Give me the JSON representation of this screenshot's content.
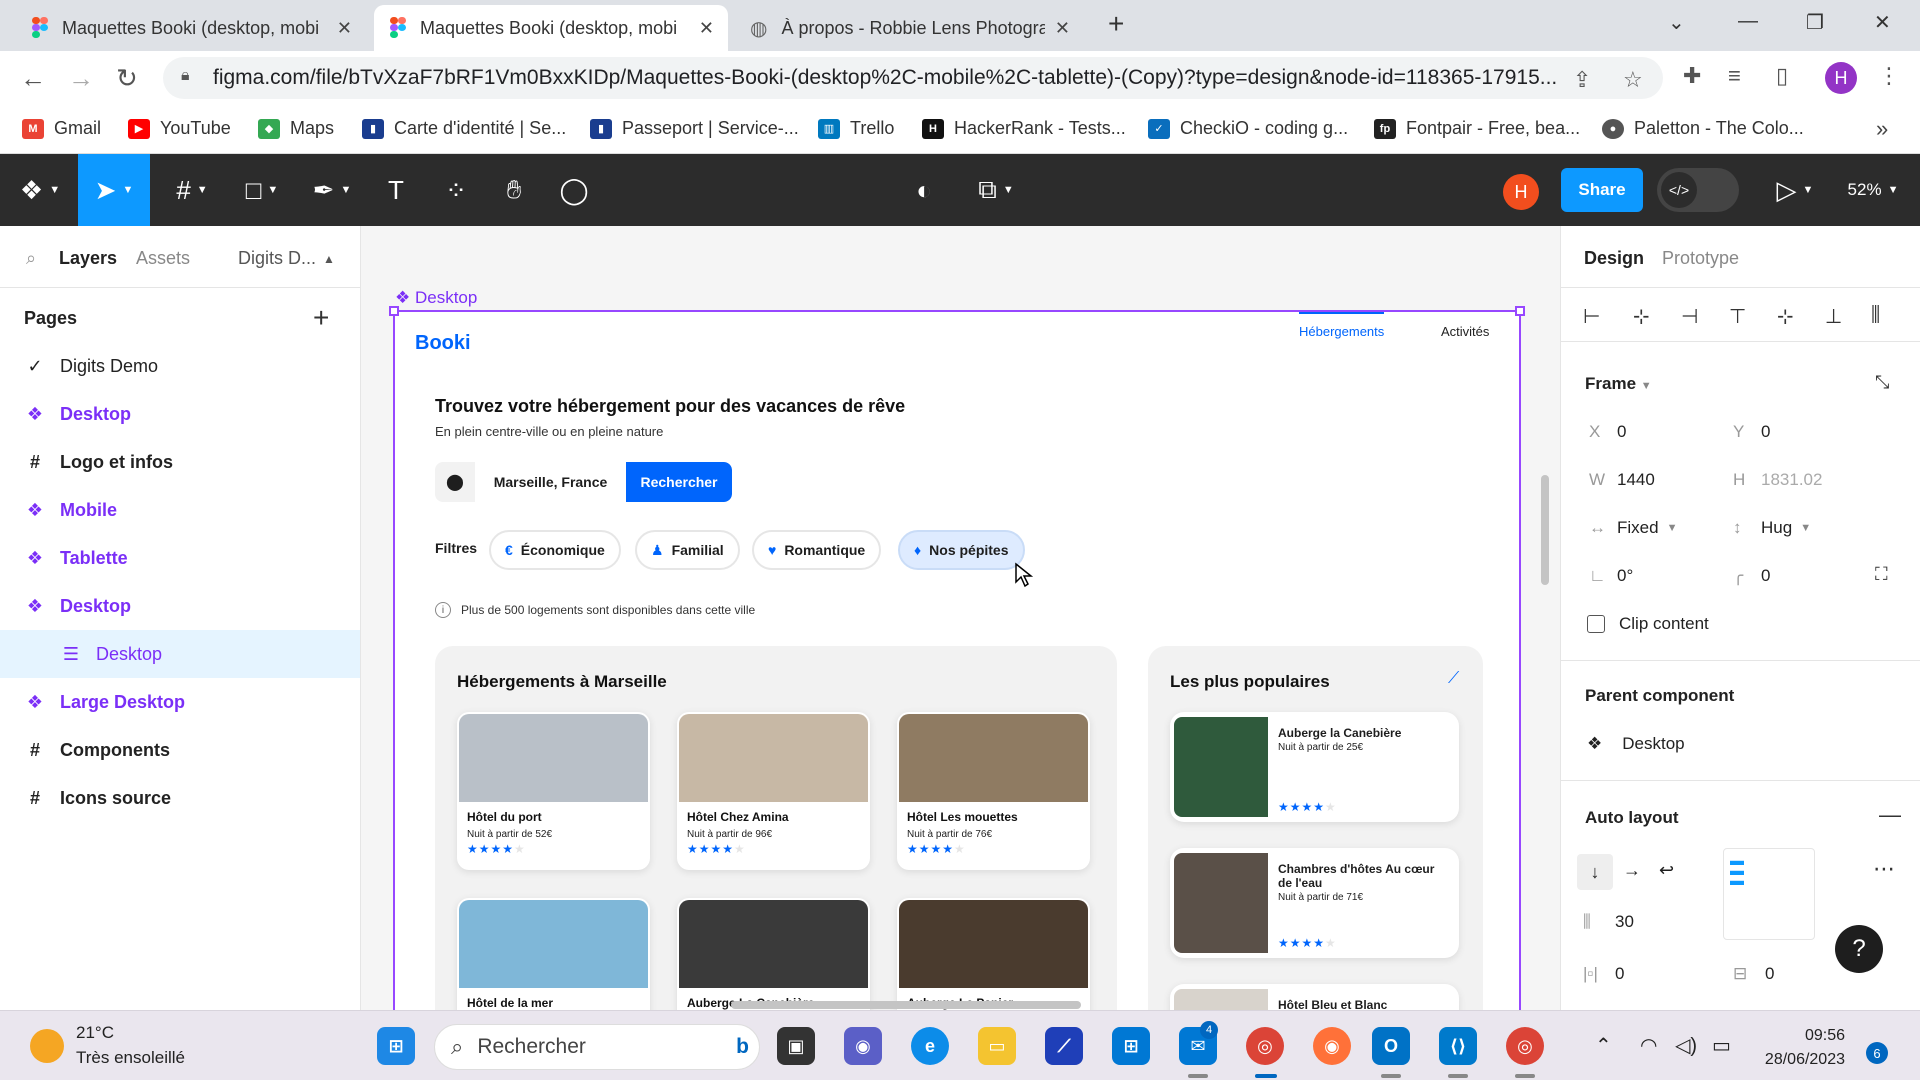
{
  "browser": {
    "tabs": [
      {
        "title": "Maquettes Booki (desktop, mobi",
        "icon": "figma-icon",
        "active": false
      },
      {
        "title": "Maquettes Booki (desktop, mobi",
        "icon": "figma-icon",
        "active": true
      },
      {
        "title": "À propos - Robbie Lens Photogra",
        "icon": "globe-icon",
        "active": false
      }
    ],
    "new_tab": "+",
    "url": "figma.com/file/bTvXzaF7bRF1Vm0BxxKIDp/Maquettes-Booki-(desktop%2C-mobile%2C-tablette)-(Copy)?type=design&node-id=118365-17915...",
    "profile_initial": "H",
    "bookmarks": [
      {
        "label": "Gmail",
        "color": "#ea4335",
        "glyph": "M"
      },
      {
        "label": "YouTube",
        "color": "#ff0000",
        "glyph": "▶"
      },
      {
        "label": "Maps",
        "color": "#34a853",
        "glyph": "◆"
      },
      {
        "label": "Carte d'identité | Se...",
        "color": "#1a3d8f",
        "glyph": "▮"
      },
      {
        "label": "Passeport | Service-...",
        "color": "#1a3d8f",
        "glyph": "▮"
      },
      {
        "label": "Trello",
        "color": "#0079bf",
        "glyph": "▥"
      },
      {
        "label": "HackerRank - Tests...",
        "color": "#111111",
        "glyph": "H"
      },
      {
        "label": "CheckiO - coding g...",
        "color": "#0a6ebd",
        "glyph": "✓"
      },
      {
        "label": "Fontpair - Free, bea...",
        "color": "#222222",
        "glyph": "fp"
      },
      {
        "label": "Paletton - The Colo...",
        "color": "#555555",
        "glyph": "●"
      }
    ],
    "bookmarks_more": "»"
  },
  "figma": {
    "toolbar": {
      "user_initial": "H",
      "share_label": "Share",
      "dev_mode_icon": "</>",
      "zoom": "52%"
    },
    "left_panel": {
      "tabs": [
        "Layers",
        "Assets"
      ],
      "file_name": "Digits D...",
      "pages_heading": "Pages",
      "pages": [
        {
          "label": "Digits Demo",
          "icon": "✓",
          "style": "current"
        },
        {
          "label": "Desktop",
          "icon": "❖",
          "style": "component"
        },
        {
          "label": "Logo et infos",
          "icon": "#",
          "style": "frame"
        },
        {
          "label": "Mobile",
          "icon": "❖",
          "style": "component"
        },
        {
          "label": "Tablette",
          "icon": "❖",
          "style": "component"
        },
        {
          "label": "Desktop",
          "icon": "❖",
          "style": "component"
        },
        {
          "label": "Desktop",
          "icon": "☰",
          "style": "sub"
        },
        {
          "label": "Large Desktop",
          "icon": "❖",
          "style": "component"
        },
        {
          "label": "Components",
          "icon": "#",
          "style": "frame"
        },
        {
          "label": "Icons source",
          "icon": "#",
          "style": "frame"
        }
      ]
    },
    "canvas": {
      "frame_label": "Desktop",
      "booki": {
        "logo": "Booki",
        "nav": [
          "Hébergements",
          "Activités"
        ],
        "title": "Trouvez votre hébergement pour des vacances de rêve",
        "subtitle": "En plein centre-ville ou en pleine nature",
        "city": "Marseille, France",
        "search_button": "Rechercher",
        "filters_label": "Filtres",
        "filters": [
          {
            "label": "Économique",
            "icon": "€"
          },
          {
            "label": "Familial",
            "icon": "♟"
          },
          {
            "label": "Romantique",
            "icon": "♥"
          },
          {
            "label": "Nos pépites",
            "icon": "♦"
          }
        ],
        "info": "Plus de 500 logements sont disponibles dans cette ville",
        "listings_title": "Hébergements à Marseille",
        "listings": [
          {
            "name": "Hôtel du port",
            "price": "Nuit à partir de 52€",
            "stars": 4,
            "color": "#b9c0c8"
          },
          {
            "name": "Hôtel Chez Amina",
            "price": "Nuit à partir de 96€",
            "stars": 4,
            "color": "#c7b8a5"
          },
          {
            "name": "Hôtel Les mouettes",
            "price": "Nuit à partir de 76€",
            "stars": 4,
            "color": "#8f7b62"
          },
          {
            "name": "Hôtel de la mer",
            "price": "",
            "stars": 0,
            "color": "#7fb7d8"
          },
          {
            "name": "Auberge La Canebière",
            "price": "",
            "stars": 0,
            "color": "#3a3a3a"
          },
          {
            "name": "Auberge Le Panier",
            "price": "",
            "stars": 0,
            "color": "#4a3b2e"
          }
        ],
        "popular_title": "Les plus populaires",
        "popular": [
          {
            "name": "Auberge la Canebière",
            "price": "Nuit à partir de 25€",
            "stars": 4,
            "color": "#2f5a3c"
          },
          {
            "name": "Chambres d'hôtes Au cœur de l'eau",
            "price": "Nuit à partir de 71€",
            "stars": 4,
            "color": "#5a5048"
          },
          {
            "name": "Hôtel Bleu et Blanc",
            "price": "",
            "stars": 0,
            "color": "#d8d3cc"
          }
        ]
      }
    },
    "right_panel": {
      "tabs": [
        "Design",
        "Prototype"
      ],
      "frame_heading": "Frame",
      "x": "0",
      "y": "0",
      "w": "1440",
      "h": "1831.02",
      "width_mode": "Fixed",
      "height_mode": "Hug",
      "rotation": "0°",
      "radius": "0",
      "clip_content": "Clip content",
      "parent_heading": "Parent component",
      "parent_name": "Desktop",
      "autolayout_heading": "Auto layout",
      "gap": "30",
      "padding_h": "0",
      "padding_v": "0",
      "help": "?"
    }
  },
  "taskbar": {
    "temp": "21°C",
    "weather": "Très ensoleillé",
    "search_placeholder": "Rechercher",
    "time": "09:56",
    "date": "28/06/2023",
    "notif_count": "6",
    "mail_badge": "4"
  }
}
